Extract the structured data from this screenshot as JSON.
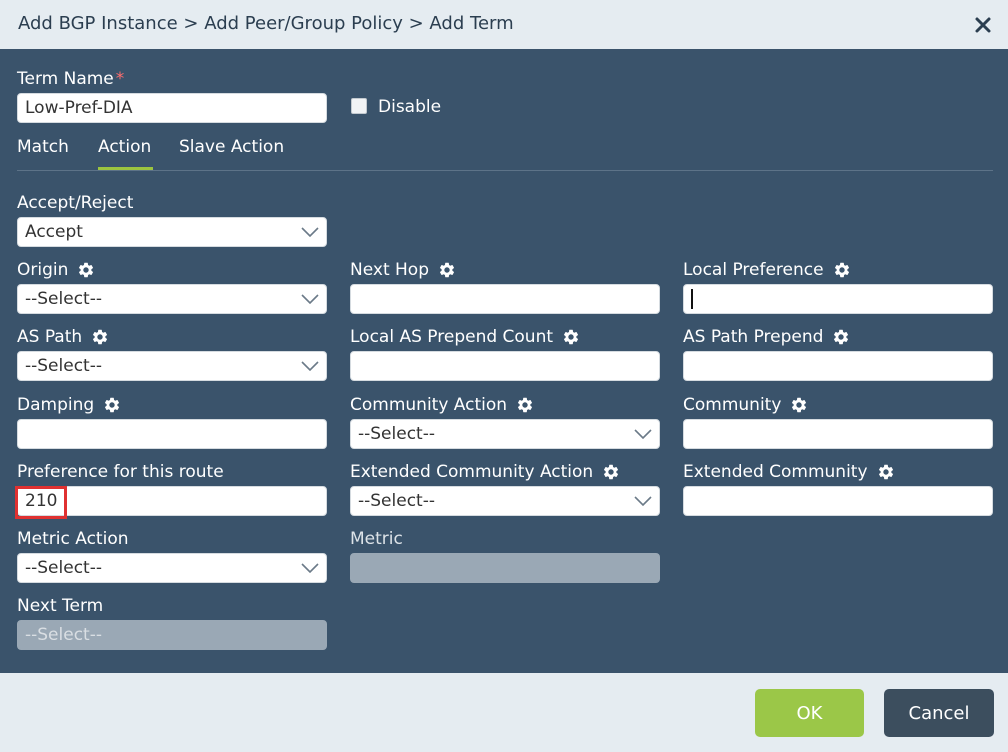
{
  "dialog": {
    "title": "Add BGP Instance > Add Peer/Group Policy > Add Term"
  },
  "term": {
    "label": "Term Name",
    "required": "*",
    "value": "Low-Pref-DIA",
    "disable_label": "Disable"
  },
  "tabs": [
    {
      "label": "Match"
    },
    {
      "label": "Action",
      "active": true
    },
    {
      "label": "Slave Action"
    }
  ],
  "fields": {
    "accept_reject": {
      "label": "Accept/Reject",
      "value": "Accept"
    },
    "origin": {
      "label": "Origin",
      "value": "--Select--"
    },
    "next_hop": {
      "label": "Next Hop",
      "value": ""
    },
    "local_preference": {
      "label": "Local Preference",
      "value": ""
    },
    "as_path": {
      "label": "AS Path",
      "value": "--Select--"
    },
    "local_as_prepend_count": {
      "label": "Local AS Prepend Count",
      "value": ""
    },
    "as_path_prepend": {
      "label": "AS Path Prepend",
      "value": ""
    },
    "damping": {
      "label": "Damping",
      "value": ""
    },
    "community_action": {
      "label": "Community Action",
      "value": "--Select--"
    },
    "community": {
      "label": "Community",
      "value": ""
    },
    "preference": {
      "label": "Preference for this route",
      "value": "210"
    },
    "extended_community_action": {
      "label": "Extended Community Action",
      "value": "--Select--"
    },
    "extended_community": {
      "label": "Extended Community",
      "value": ""
    },
    "metric_action": {
      "label": "Metric Action",
      "value": "--Select--"
    },
    "metric": {
      "label": "Metric",
      "value": ""
    },
    "next_term": {
      "label": "Next Term",
      "value": "--Select--"
    }
  },
  "buttons": {
    "ok": "OK",
    "cancel": "Cancel"
  },
  "colors": {
    "body_bg": "#3a536b",
    "accent_green": "#9bc748",
    "highlight_red": "#e03131"
  },
  "icons": {
    "close": "close-icon",
    "gear": "gear-icon",
    "chevron": "chevron-down-icon"
  }
}
